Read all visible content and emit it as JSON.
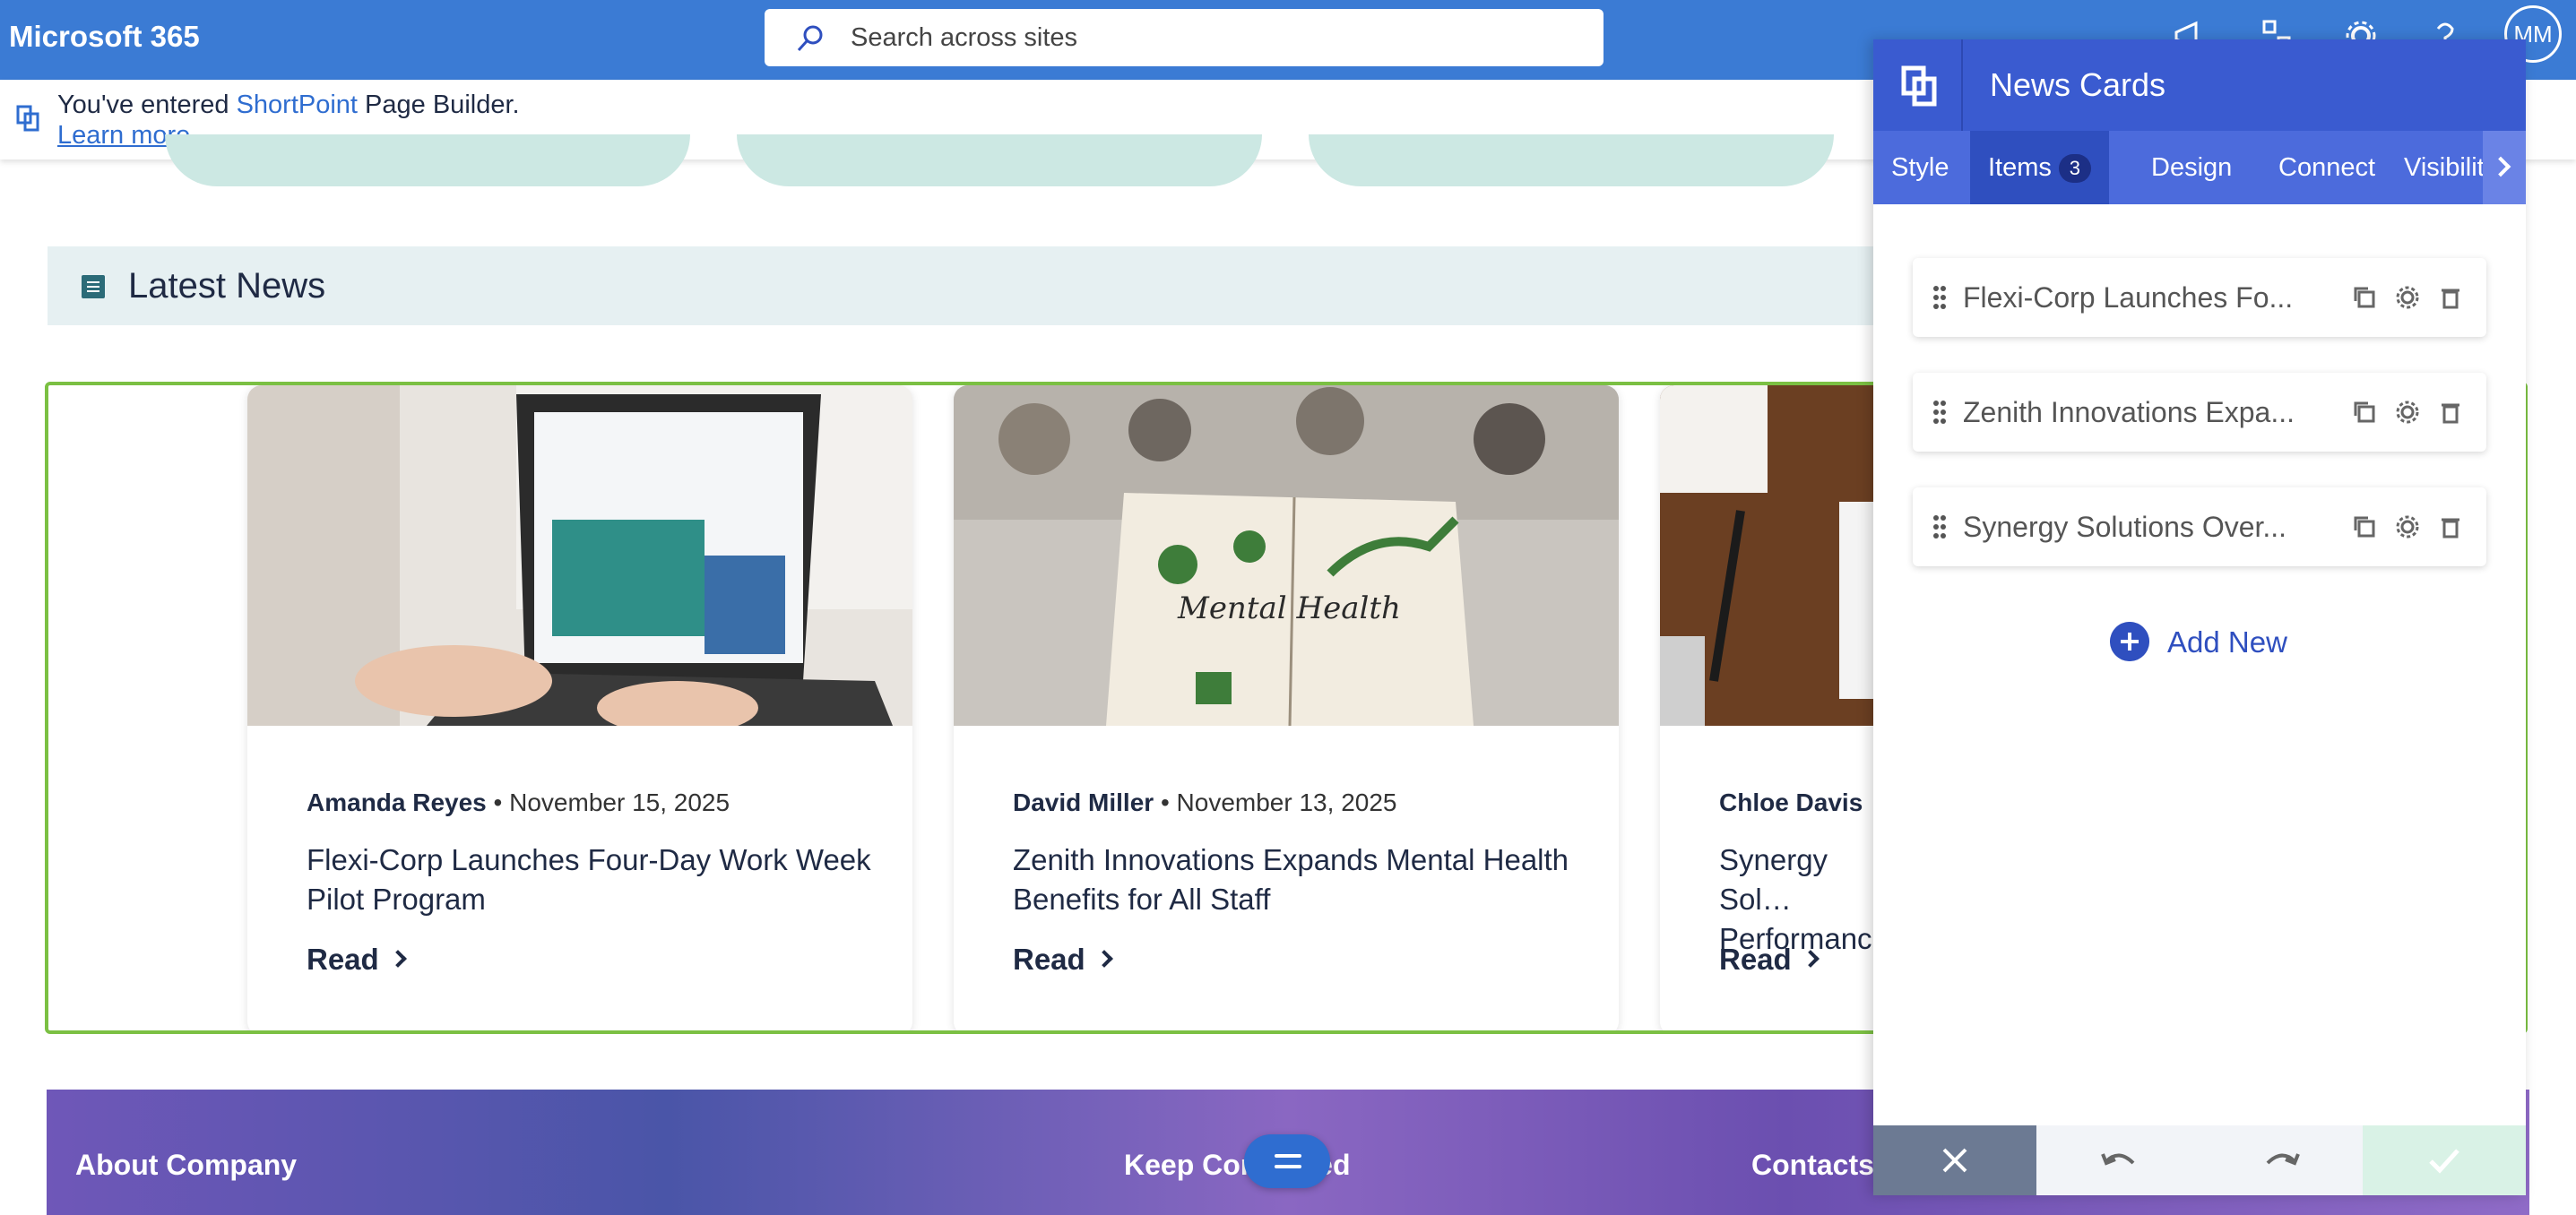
{
  "topbar": {
    "brand": "Microsoft 365",
    "search_placeholder": "Search across sites",
    "avatar_initials": "MM"
  },
  "notice": {
    "prefix": "You've entered ",
    "product": "ShortPoint",
    "suffix": " Page Builder.",
    "link": "Learn more"
  },
  "section": {
    "title": "Latest News"
  },
  "cards": [
    {
      "author": "Amanda Reyes",
      "date": "November 15, 2025",
      "title": "Flexi-Corp Launches Four-Day Work Week Pilot Program",
      "read": "Read"
    },
    {
      "author": "David Miller",
      "date": "November 13, 2025",
      "title": "Zenith Innovations Expands Mental Health Benefits for All Staff",
      "read": "Read"
    },
    {
      "author": "Chloe Davis",
      "date": "",
      "title": "Synergy Sol… Performanc…",
      "read": "Read"
    }
  ],
  "footer": {
    "about": "About Company",
    "keep": "Keep Connected",
    "contacts": "Contacts"
  },
  "panel": {
    "title": "News Cards",
    "tabs": [
      "Style",
      "Items",
      "Design",
      "Connect",
      "Visibility"
    ],
    "items_count": "3",
    "items": [
      "Flexi-Corp Launches Fo...",
      "Zenith Innovations Expa...",
      "Synergy Solutions Over..."
    ],
    "add_new": "Add New"
  },
  "colors": {
    "topbar": "#3b7bd4",
    "panel_header": "#3a5bd0",
    "accent": "#2f4fbf",
    "selection_border": "#7bc043"
  }
}
